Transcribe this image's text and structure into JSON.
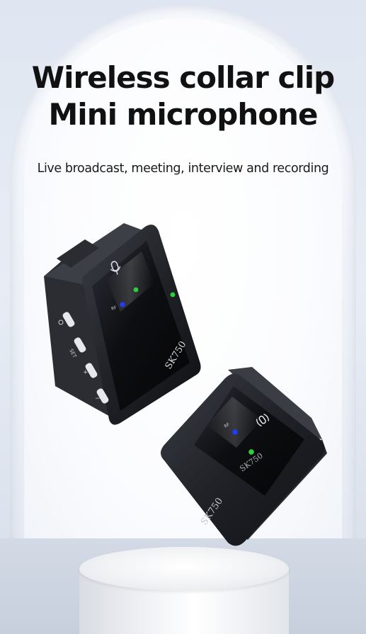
{
  "headline": {
    "line1": "Wireless collar clip",
    "line2": "Mini microphone"
  },
  "subtitle": "Live broadcast, meeting, interview and recording",
  "devices": {
    "transmitter": {
      "model": "SK750",
      "buttons": [
        "SET",
        "+",
        "−"
      ],
      "led_label": "RF",
      "led_colors": [
        "#1f3cff",
        "#29d13c",
        "#29d13c"
      ]
    },
    "receiver": {
      "model": "SK750",
      "screen_model": "SK750",
      "led_label": "RF",
      "led_colors": [
        "#1f3cff",
        "#29d13c"
      ]
    }
  },
  "colors": {
    "background": "#dfe6f1",
    "device_body": "#1c1e22",
    "device_glass": "#0b0c0f"
  }
}
